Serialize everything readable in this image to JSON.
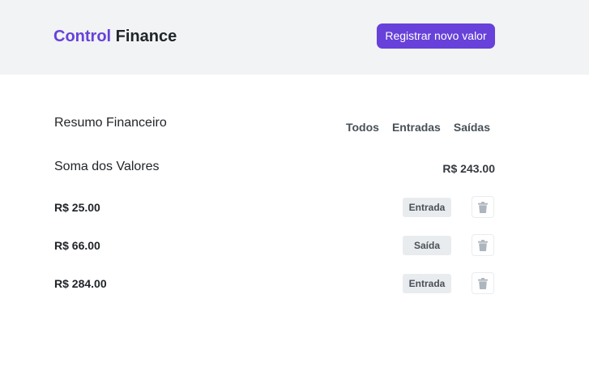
{
  "header": {
    "logo_accent": "Control",
    "logo_rest": "Finance",
    "register_button": "Registrar novo valor"
  },
  "summary": {
    "title": "Resumo Financeiro",
    "filters": [
      "Todos",
      "Entradas",
      "Saídas"
    ],
    "sum_label": "Soma dos Valores",
    "sum_value": "R$ 243.00"
  },
  "entries": [
    {
      "value": "R$ 25.00",
      "type": "Entrada"
    },
    {
      "value": "R$ 66.00",
      "type": "Saída"
    },
    {
      "value": "R$ 284.00",
      "type": "Entrada"
    }
  ],
  "icons": {
    "delete": "trash-icon"
  },
  "colors": {
    "brand": "#6741d9",
    "header_bg": "#f1f3f5",
    "tag_bg": "#e9ecef",
    "trash_icon": "#adb5bd"
  }
}
